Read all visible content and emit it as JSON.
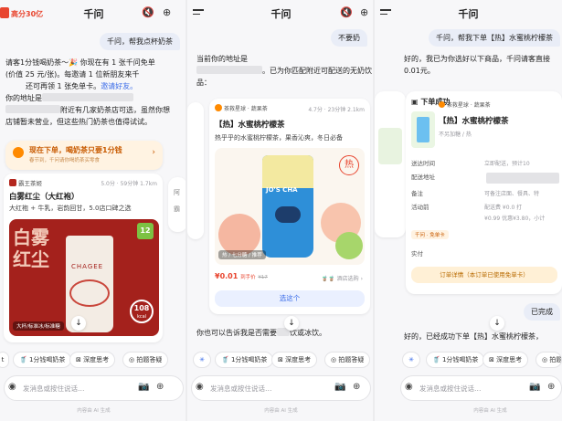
{
  "panel1": {
    "logo": "高分30亿",
    "title": "千问",
    "user_msg": "千问，帮我点杯奶茶",
    "ai_line1": "请客1分钱喝奶茶～🎉 你现在有 1 张千问免单",
    "ai_line2": "(价值 25 元/张)。每邀请 1 位新朋友来千",
    "ai_line3": "还可再领 1 张免单卡。",
    "ai_link": "邀请好友。",
    "ai_line4": "你的地址是",
    "ai_line5": "附近有几家奶茶店可选，虽然你想",
    "ai_line6": "店铺暂未营业，但这些热门奶茶也值得试试。",
    "promo_title": "现在下单，喝奶茶只要1分钱",
    "promo_sub": "春节到，千问请你喝奶茶买零食",
    "shop_name": "霸王茶姬",
    "shop_meta": "5.0分 · 59分钟 1.7km",
    "product_name": "白雾红尘（大红袍）",
    "product_desc": "大红袍 + 牛乳，岩韵回甘，5.0店口碑之选",
    "image_text": "白雾红尘",
    "image_brand": "CHAGEE",
    "badge_num": "12",
    "kcal_num": "108",
    "kcal_unit": "kcal",
    "image_tag": "大杯/标准冰/标准糖",
    "chips": [
      "1分钱喝奶茶",
      "深度思考",
      "拍题答疑"
    ],
    "input_placeholder": "发消息或按住说话…",
    "disclaimer": "内容由 AI 生成"
  },
  "panel2": {
    "title": "千问",
    "user_msg": "不要奶",
    "ai_line1": "当前你的地址是",
    "ai_line2": "。已为你匹配附近可配送的无奶饮",
    "ai_line3": "品：",
    "shop_name": "茶救星球 · 蔬果茶",
    "shop_meta": "4.7分 · 23分钟 2.1km",
    "product_name": "【热】水蜜桃柠檬茶",
    "product_desc": "热乎乎的水蜜桃柠檬茶，果香沁爽，冬日必备",
    "cup_brand": "JO'S CHA",
    "hot_badge": "热",
    "image_tag": "热 / 七分糖 / 推荐",
    "price_now": "¥0.01",
    "price_suffix": "到手价",
    "price_old": "¥17",
    "stores_label": "酒店选购",
    "select_button": "选这个",
    "ai_follow": "你也可以告诉我是否需要",
    "ai_follow2": "饮或冰饮。",
    "chips": [
      "1分钱喝奶茶",
      "深度思考",
      "拍题答疑"
    ],
    "input_placeholder": "发消息或按住说话…",
    "disclaimer": "内容由 AI 生成"
  },
  "panel3": {
    "title": "千问",
    "user_msg": "千问，帮我下单【热】水蜜桃柠檬茶",
    "ai_line1": "好的，我已为你选好以下商品，千问请客直接",
    "ai_line2": "0.01元。",
    "order_status": "下单成功",
    "shop_name": "茶救星球 · 蔬果茶",
    "product_name": "【热】水蜜桃柠檬茶",
    "product_spec": "不另加糖 / 热",
    "rows": [
      {
        "label": "送达时间",
        "value": "立即配送，预计10"
      },
      {
        "label": "配送地址",
        "value": ""
      },
      {
        "label": "备注",
        "value": "可备注店面、餐具、特"
      },
      {
        "label": "活动前",
        "value": "配送费 ¥0.0  打"
      },
      {
        "label": "",
        "value": "¥0.99  优惠¥3.80，小计"
      }
    ],
    "discount_tag": "千问 · 免单卡",
    "paid_label": "实付",
    "detail_button": "订单详情（本订单已使用免单卡）",
    "right_bubble": "已完成",
    "bottom_text": "好的，已经成功下单【热】水蜜桃柠檬茶，",
    "chips": [
      "1分钱喝奶茶",
      "深度思考",
      "拍题答疑"
    ],
    "input_placeholder": "发消息或按住说话…",
    "disclaimer": "内容由 AI 生成"
  },
  "colors": {
    "accent": "#3a6be8",
    "brand_red": "#e8452f",
    "promo_orange": "#fff3e2"
  }
}
